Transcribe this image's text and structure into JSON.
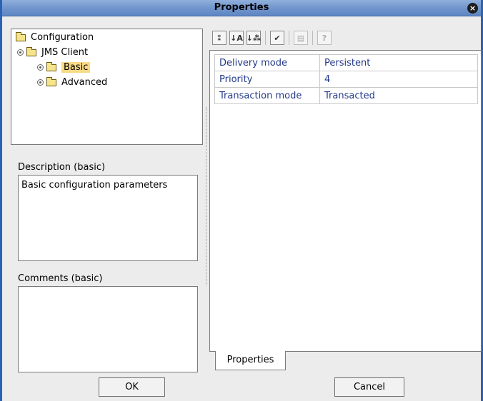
{
  "window": {
    "title": "Properties"
  },
  "tree": {
    "items": [
      {
        "label": "Configuration"
      },
      {
        "label": "JMS Client"
      },
      {
        "label": "Basic"
      },
      {
        "label": "Advanced"
      }
    ]
  },
  "description": {
    "label": "Description (basic)",
    "text": "Basic configuration parameters"
  },
  "comments": {
    "label": "Comments (basic)",
    "text": ""
  },
  "toolbar": {
    "icons": [
      "sort-category-icon",
      "sort-alpha-icon",
      "sort-properties-icon",
      "filter-icon",
      "view-icon",
      "help-icon"
    ],
    "glyphs": [
      "⁑",
      "↓A",
      "↓⁂",
      "✔",
      "▤",
      "?"
    ]
  },
  "properties": {
    "rows": [
      {
        "key": "Delivery mode",
        "value": "Persistent"
      },
      {
        "key": "Priority",
        "value": "4"
      },
      {
        "key": "Transaction mode",
        "value": "Transacted"
      }
    ],
    "tab_label": "Properties"
  },
  "buttons": {
    "ok": "OK",
    "cancel": "Cancel"
  }
}
